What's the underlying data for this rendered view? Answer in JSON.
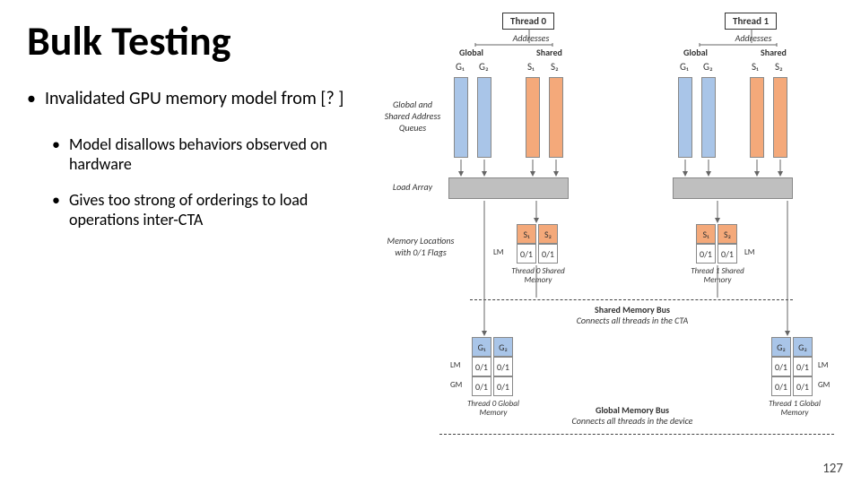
{
  "title": "Bulk Testing",
  "bullets": {
    "b1": "Invalidated GPU memory model from [? ]",
    "b2a": "Model disallows behaviors observed on hardware",
    "b2b": "Gives too strong of orderings to load operations inter-CTA"
  },
  "threads": {
    "t0": "Thread 0",
    "t1": "Thread 1"
  },
  "headers": {
    "addresses": "Addresses",
    "global": "Global",
    "shared": "Shared"
  },
  "queuesLabel": "Global and Shared Address Queues",
  "cols": {
    "g1": "G₁",
    "g2": "G₂",
    "s1": "S₁",
    "s2": "S₂"
  },
  "loadArray": "Load Array",
  "memLoc": "Memory Locations with 0/1 Flags",
  "lm": "LM",
  "gm": "GM",
  "shm": {
    "t0": "Thread 0 Shared Memory",
    "t1": "Thread 1 Shared Memory"
  },
  "shmBus": {
    "title": "Shared Memory Bus",
    "sub": "Connects all threads in the CTA"
  },
  "gmem": {
    "t0": "Thread 0 Global Memory",
    "t1": "Thread 1 Global Memory"
  },
  "gmBus": {
    "title": "Global Memory Bus",
    "sub": "Connects all threads in the device"
  },
  "flag": "0/1",
  "page": "127"
}
